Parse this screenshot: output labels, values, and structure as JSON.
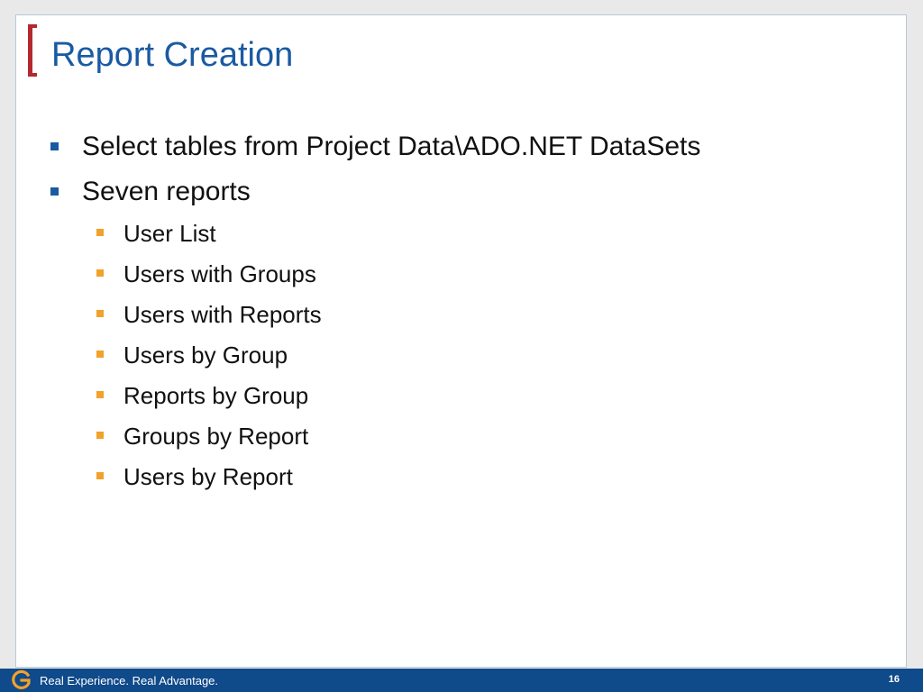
{
  "slide": {
    "title": "Report Creation",
    "bullets": [
      "Select tables from Project Data\\ADO.NET DataSets",
      "Seven reports"
    ],
    "sub_bullets": [
      "User List",
      "Users with Groups",
      "Users with Reports",
      "Users by Group",
      "Reports by Group",
      "Groups by Report",
      "Users by Report"
    ]
  },
  "footer": {
    "tagline": "Real Experience. Real Advantage.",
    "page_number": "16",
    "logo_icon": "g-logo-icon"
  },
  "colors": {
    "title": "#1a5aa2",
    "accent_bracket": "#b5282e",
    "bullet_primary": "#1a5aa2",
    "bullet_secondary": "#f2a12b",
    "footer_bar": "#0f4a8a"
  }
}
